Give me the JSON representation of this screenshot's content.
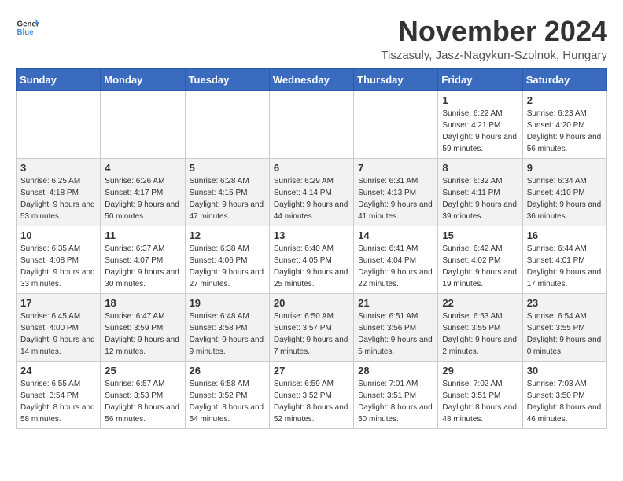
{
  "header": {
    "logo_general": "General",
    "logo_blue": "Blue",
    "month_title": "November 2024",
    "subtitle": "Tiszasuly, Jasz-Nagykun-Szolnok, Hungary"
  },
  "columns": [
    "Sunday",
    "Monday",
    "Tuesday",
    "Wednesday",
    "Thursday",
    "Friday",
    "Saturday"
  ],
  "weeks": [
    [
      {
        "day": "",
        "detail": ""
      },
      {
        "day": "",
        "detail": ""
      },
      {
        "day": "",
        "detail": ""
      },
      {
        "day": "",
        "detail": ""
      },
      {
        "day": "",
        "detail": ""
      },
      {
        "day": "1",
        "detail": "Sunrise: 6:22 AM\nSunset: 4:21 PM\nDaylight: 9 hours and 59 minutes."
      },
      {
        "day": "2",
        "detail": "Sunrise: 6:23 AM\nSunset: 4:20 PM\nDaylight: 9 hours and 56 minutes."
      }
    ],
    [
      {
        "day": "3",
        "detail": "Sunrise: 6:25 AM\nSunset: 4:18 PM\nDaylight: 9 hours and 53 minutes."
      },
      {
        "day": "4",
        "detail": "Sunrise: 6:26 AM\nSunset: 4:17 PM\nDaylight: 9 hours and 50 minutes."
      },
      {
        "day": "5",
        "detail": "Sunrise: 6:28 AM\nSunset: 4:15 PM\nDaylight: 9 hours and 47 minutes."
      },
      {
        "day": "6",
        "detail": "Sunrise: 6:29 AM\nSunset: 4:14 PM\nDaylight: 9 hours and 44 minutes."
      },
      {
        "day": "7",
        "detail": "Sunrise: 6:31 AM\nSunset: 4:13 PM\nDaylight: 9 hours and 41 minutes."
      },
      {
        "day": "8",
        "detail": "Sunrise: 6:32 AM\nSunset: 4:11 PM\nDaylight: 9 hours and 39 minutes."
      },
      {
        "day": "9",
        "detail": "Sunrise: 6:34 AM\nSunset: 4:10 PM\nDaylight: 9 hours and 36 minutes."
      }
    ],
    [
      {
        "day": "10",
        "detail": "Sunrise: 6:35 AM\nSunset: 4:08 PM\nDaylight: 9 hours and 33 minutes."
      },
      {
        "day": "11",
        "detail": "Sunrise: 6:37 AM\nSunset: 4:07 PM\nDaylight: 9 hours and 30 minutes."
      },
      {
        "day": "12",
        "detail": "Sunrise: 6:38 AM\nSunset: 4:06 PM\nDaylight: 9 hours and 27 minutes."
      },
      {
        "day": "13",
        "detail": "Sunrise: 6:40 AM\nSunset: 4:05 PM\nDaylight: 9 hours and 25 minutes."
      },
      {
        "day": "14",
        "detail": "Sunrise: 6:41 AM\nSunset: 4:04 PM\nDaylight: 9 hours and 22 minutes."
      },
      {
        "day": "15",
        "detail": "Sunrise: 6:42 AM\nSunset: 4:02 PM\nDaylight: 9 hours and 19 minutes."
      },
      {
        "day": "16",
        "detail": "Sunrise: 6:44 AM\nSunset: 4:01 PM\nDaylight: 9 hours and 17 minutes."
      }
    ],
    [
      {
        "day": "17",
        "detail": "Sunrise: 6:45 AM\nSunset: 4:00 PM\nDaylight: 9 hours and 14 minutes."
      },
      {
        "day": "18",
        "detail": "Sunrise: 6:47 AM\nSunset: 3:59 PM\nDaylight: 9 hours and 12 minutes."
      },
      {
        "day": "19",
        "detail": "Sunrise: 6:48 AM\nSunset: 3:58 PM\nDaylight: 9 hours and 9 minutes."
      },
      {
        "day": "20",
        "detail": "Sunrise: 6:50 AM\nSunset: 3:57 PM\nDaylight: 9 hours and 7 minutes."
      },
      {
        "day": "21",
        "detail": "Sunrise: 6:51 AM\nSunset: 3:56 PM\nDaylight: 9 hours and 5 minutes."
      },
      {
        "day": "22",
        "detail": "Sunrise: 6:53 AM\nSunset: 3:55 PM\nDaylight: 9 hours and 2 minutes."
      },
      {
        "day": "23",
        "detail": "Sunrise: 6:54 AM\nSunset: 3:55 PM\nDaylight: 9 hours and 0 minutes."
      }
    ],
    [
      {
        "day": "24",
        "detail": "Sunrise: 6:55 AM\nSunset: 3:54 PM\nDaylight: 8 hours and 58 minutes."
      },
      {
        "day": "25",
        "detail": "Sunrise: 6:57 AM\nSunset: 3:53 PM\nDaylight: 8 hours and 56 minutes."
      },
      {
        "day": "26",
        "detail": "Sunrise: 6:58 AM\nSunset: 3:52 PM\nDaylight: 8 hours and 54 minutes."
      },
      {
        "day": "27",
        "detail": "Sunrise: 6:59 AM\nSunset: 3:52 PM\nDaylight: 8 hours and 52 minutes."
      },
      {
        "day": "28",
        "detail": "Sunrise: 7:01 AM\nSunset: 3:51 PM\nDaylight: 8 hours and 50 minutes."
      },
      {
        "day": "29",
        "detail": "Sunrise: 7:02 AM\nSunset: 3:51 PM\nDaylight: 8 hours and 48 minutes."
      },
      {
        "day": "30",
        "detail": "Sunrise: 7:03 AM\nSunset: 3:50 PM\nDaylight: 8 hours and 46 minutes."
      }
    ]
  ]
}
